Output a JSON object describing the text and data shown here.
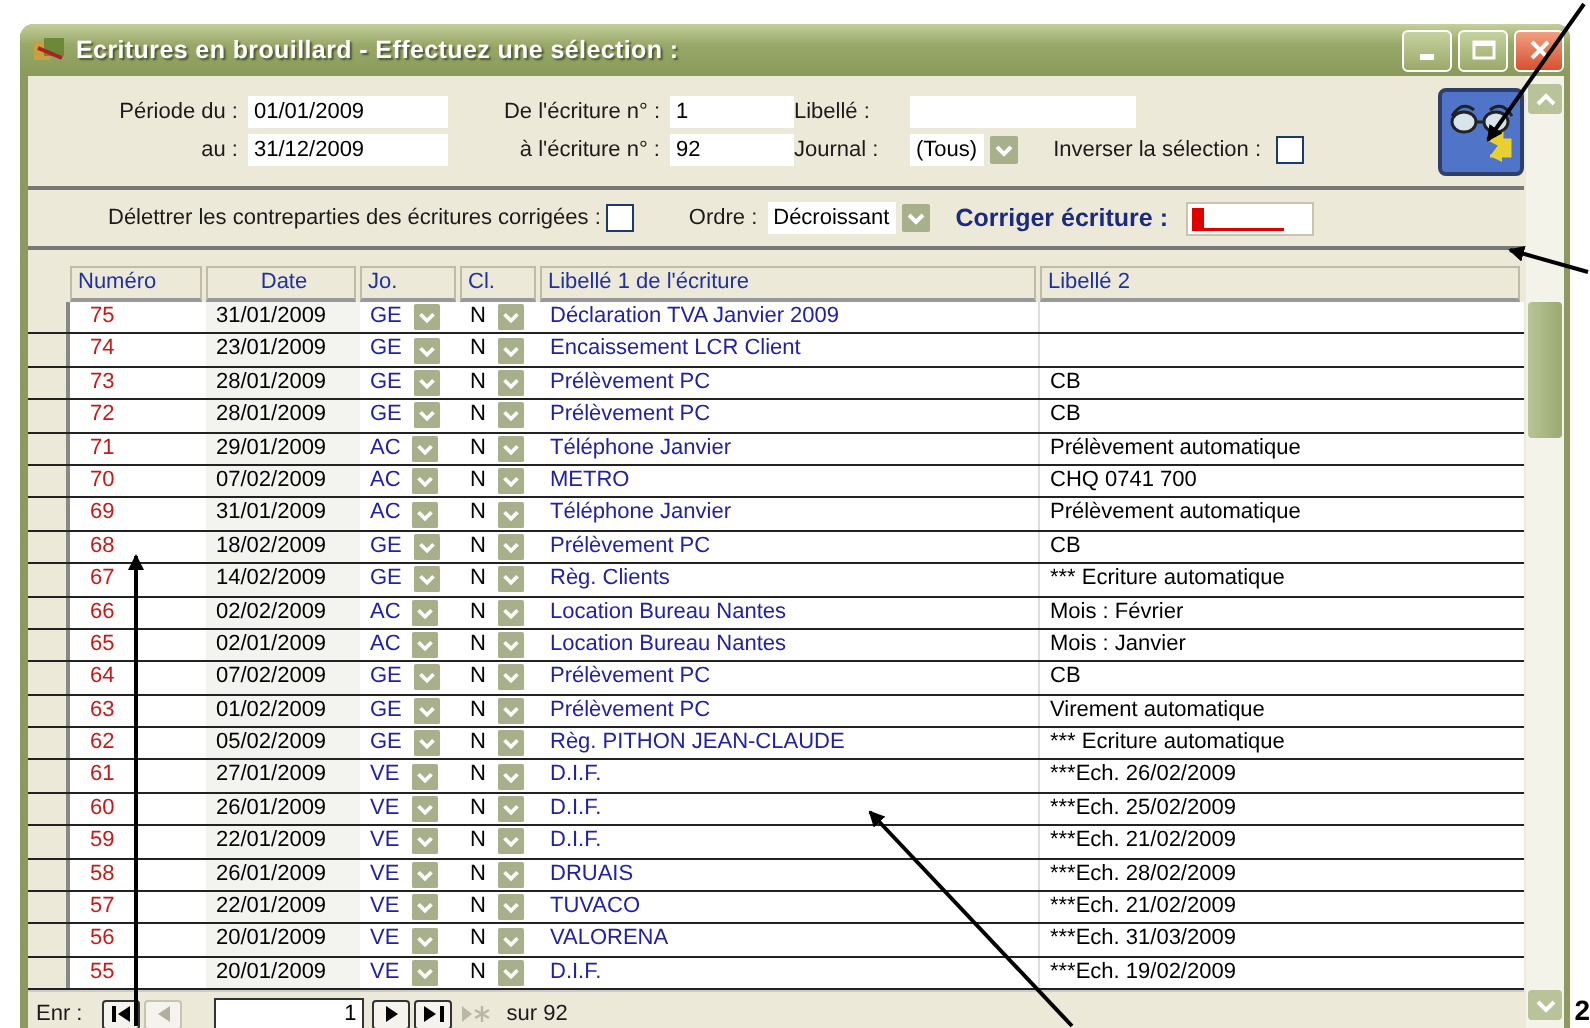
{
  "window": {
    "title": "Ecritures en brouillard - Effectuez une sélection :"
  },
  "filters": {
    "period_from": {
      "label": "Période du :",
      "value": "01/01/2009"
    },
    "period_to": {
      "label": "au :",
      "value": "31/12/2009"
    },
    "entry_from": {
      "label": "De l'écriture n° :",
      "value": "1"
    },
    "entry_to": {
      "label": "à l'écriture n° :",
      "value": "92"
    },
    "libelle": {
      "label": "Libellé :"
    },
    "journal": {
      "label": "Journal :",
      "value": "(Tous)"
    },
    "invert": {
      "label": "Inverser la sélection :",
      "checked": false
    }
  },
  "options": {
    "unletter": {
      "label": "Délettrer les contreparties des écritures corrigées :",
      "checked": false
    },
    "order": {
      "label": "Ordre :",
      "value": "Décroissant"
    },
    "correct": {
      "label": "Corriger écriture :"
    }
  },
  "table": {
    "columns": [
      "Numéro",
      "Date",
      "Jo.",
      "Cl.",
      "Libellé 1 de l'écriture",
      "Libellé 2"
    ],
    "rows": [
      {
        "numero": "75",
        "date": "31/01/2009",
        "journal": "GE",
        "classe": "N",
        "libelle_1": "Déclaration TVA Janvier 2009"
      },
      {
        "numero": "74",
        "date": "23/01/2009",
        "journal": "GE",
        "classe": "N",
        "libelle_1": "Encaissement LCR Client"
      },
      {
        "numero": "73",
        "date": "28/01/2009",
        "journal": "GE",
        "classe": "N",
        "libelle_1": "Prélèvement PC",
        "libelle_2": "CB"
      },
      {
        "numero": "72",
        "date": "28/01/2009",
        "journal": "GE",
        "classe": "N",
        "libelle_1": "Prélèvement PC",
        "libelle_2": "CB"
      },
      {
        "numero": "71",
        "date": "29/01/2009",
        "journal": "AC",
        "classe": "N",
        "libelle_1": "Téléphone Janvier",
        "libelle_2": "Prélèvement automatique"
      },
      {
        "numero": "70",
        "date": "07/02/2009",
        "journal": "AC",
        "classe": "N",
        "libelle_1": "METRO",
        "libelle_2": "CHQ 0741 700"
      },
      {
        "numero": "69",
        "date": "31/01/2009",
        "journal": "AC",
        "classe": "N",
        "libelle_1": "Téléphone Janvier",
        "libelle_2": "Prélèvement automatique"
      },
      {
        "numero": "68",
        "date": "18/02/2009",
        "journal": "GE",
        "classe": "N",
        "libelle_1": "Prélèvement PC",
        "libelle_2": "CB"
      },
      {
        "numero": "67",
        "date": "14/02/2009",
        "journal": "GE",
        "classe": "N",
        "libelle_1": "Règ. Clients",
        "libelle_2": "*** Ecriture automatique"
      },
      {
        "numero": "66",
        "date": "02/02/2009",
        "journal": "AC",
        "classe": "N",
        "libelle_1": "Location Bureau Nantes",
        "libelle_2": "Mois : Février"
      },
      {
        "numero": "65",
        "date": "02/01/2009",
        "journal": "AC",
        "classe": "N",
        "libelle_1": "Location Bureau Nantes",
        "libelle_2": "Mois : Janvier"
      },
      {
        "numero": "64",
        "date": "07/02/2009",
        "journal": "GE",
        "classe": "N",
        "libelle_1": "Prélèvement PC",
        "libelle_2": "CB"
      },
      {
        "numero": "63",
        "date": "01/02/2009",
        "journal": "GE",
        "classe": "N",
        "libelle_1": "Prélèvement PC",
        "libelle_2": "Virement automatique"
      },
      {
        "numero": "62",
        "date": "05/02/2009",
        "journal": "GE",
        "classe": "N",
        "libelle_1": "Règ. PITHON JEAN-CLAUDE",
        "libelle_2": "*** Ecriture automatique"
      },
      {
        "numero": "61",
        "date": "27/01/2009",
        "journal": "VE",
        "classe": "N",
        "libelle_1": "D.I.F.",
        "libelle_2": "***Ech. 26/02/2009"
      },
      {
        "numero": "60",
        "date": "26/01/2009",
        "journal": "VE",
        "classe": "N",
        "libelle_1": "D.I.F.",
        "libelle_2": "***Ech. 25/02/2009"
      },
      {
        "numero": "59",
        "date": "22/01/2009",
        "journal": "VE",
        "classe": "N",
        "libelle_1": "D.I.F.",
        "libelle_2": "***Ech. 21/02/2009"
      },
      {
        "numero": "58",
        "date": "26/01/2009",
        "journal": "VE",
        "classe": "N",
        "libelle_1": "DRUAIS",
        "libelle_2": "***Ech. 28/02/2009"
      },
      {
        "numero": "57",
        "date": "22/01/2009",
        "journal": "VE",
        "classe": "N",
        "libelle_1": "TUVACO",
        "libelle_2": "***Ech. 21/02/2009"
      },
      {
        "numero": "56",
        "date": "20/01/2009",
        "journal": "VE",
        "classe": "N",
        "libelle_1": "VALORENA",
        "libelle_2": "***Ech. 31/03/2009"
      },
      {
        "numero": "55",
        "date": "20/01/2009",
        "journal": "VE",
        "classe": "N",
        "libelle_1": "D.I.F.",
        "libelle_2": "***Ech. 19/02/2009"
      }
    ]
  },
  "navigator": {
    "label": "Enr :",
    "buttons": [
      {
        "kind": "first",
        "disabled": false
      },
      {
        "kind": "prev",
        "disabled": true
      },
      {
        "kind": "next",
        "disabled": false
      },
      {
        "kind": "last",
        "disabled": false
      },
      {
        "kind": "new",
        "disabled": true
      }
    ],
    "record": "1",
    "total": "sur 92"
  },
  "annotation": {
    "label": "2"
  }
}
